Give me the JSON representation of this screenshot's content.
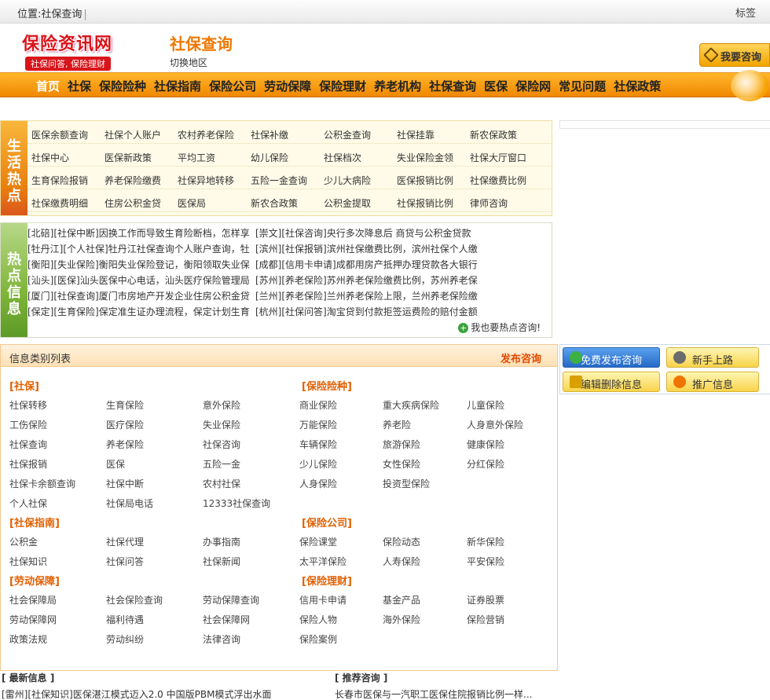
{
  "topbar": {
    "location_label": "位置:社保查询",
    "tags_label": "标签"
  },
  "header": {
    "logo_text": "保险资讯网",
    "logo_slogan": "社保问答, 保险理财",
    "page_title": "社保查询",
    "switch_region": "切换地区",
    "ask_button": "我要咨询"
  },
  "nav": {
    "items": [
      "首页",
      "社保",
      "保险险种",
      "社保指南",
      "保险公司",
      "劳动保障",
      "保险理财",
      "养老机构",
      "社保查询",
      "医保",
      "保险网",
      "常见问题",
      "社保政策"
    ]
  },
  "hot": {
    "tab_label": "生活热点",
    "rows": [
      [
        "医保余额查询",
        "社保个人账户",
        "农村养老保险",
        "社保补缴",
        "公积金查询",
        "社保挂靠",
        "新农保政策"
      ],
      [
        "社保中心",
        "医保新政策",
        "平均工资",
        "幼儿保险",
        "社保档次",
        "失业保险金领",
        "社保大厅窗口"
      ],
      [
        "生育保险报销",
        "养老保险缴费",
        "社保异地转移",
        "五险一金查询",
        "少儿大病险",
        "医保报销比例",
        "社保缴费比例"
      ],
      [
        "社保缴费明细",
        "住房公积金贷",
        "医保局",
        "新农合政策",
        "公积金提取",
        "社保报销比例",
        "律师咨询"
      ]
    ]
  },
  "news": {
    "tab_label": "热点信息",
    "lines": [
      [
        "[北碚][社保中断]因换工作而导致生育险断档，怎样享",
        "[崇文][社保咨询]央行多次降息后 商贷与公积金贷款"
      ],
      [
        "[牡丹江][个人社保]牡丹江社保查询个人账户查询，牡",
        "[滨州][社保报销]滨州社保缴费比例，滨州社保个人缴"
      ],
      [
        "[衡阳][失业保险]衡阳失业保险登记，衡阳领取失业保",
        "[成都][信用卡申请]成都用房产抵押办理贷款各大银行"
      ],
      [
        "[汕头][医保]汕头医保中心电话，汕头医疗保险管理局",
        "[苏州][养老保险]苏州养老保险缴费比例，苏州养老保"
      ],
      [
        "[厦门][社保查询]厦门市房地产开发企业住房公积金贷",
        "[兰州][养老保险]兰州养老保险上限，兰州养老保险缴"
      ],
      [
        "[保定][生育保险]保定准生证办理流程，保定计划生育",
        "[杭州][社保问答]淘宝贷到付款拒签运费险的赔付金额"
      ]
    ],
    "more_label": "我也要热点咨询!"
  },
  "info": {
    "title": "信息类别列表",
    "publish": "发布咨询",
    "categories": [
      {
        "name": "[社保]",
        "links": [
          "社保转移",
          "生育保险",
          "意外保险",
          "工伤保险",
          "医疗保险",
          "失业保险",
          "社保查询",
          "养老保险",
          "社保咨询",
          "社保报销",
          "医保",
          "五险一金",
          "社保卡余额查询",
          "社保中断",
          "农村社保",
          "个人社保",
          "社保局电话",
          "12333社保查询"
        ]
      },
      {
        "name": "[保险险种]",
        "links": [
          "商业保险",
          "重大疾病保险",
          "儿童保险",
          "万能保险",
          "养老险",
          "人身意外保险",
          "车辆保险",
          "旅游保险",
          "健康保险",
          "少儿保险",
          "女性保险",
          "分红保险",
          "人身保险",
          "投资型保险"
        ]
      },
      {
        "name": "[社保指南]",
        "links": [
          "公积金",
          "社保代理",
          "办事指南",
          "社保知识",
          "社保问答",
          "社保新闻"
        ]
      },
      {
        "name": "[保险公司]",
        "links": [
          "保险课堂",
          "保险动态",
          "新华保险",
          "太平洋保险",
          "人寿保险",
          "平安保险"
        ]
      },
      {
        "name": "[劳动保障]",
        "links": [
          "社会保障局",
          "社会保险查询",
          "劳动保障查询",
          "劳动保障网",
          "福利待遇",
          "社会保障网",
          "政策法规",
          "劳动纠纷",
          "法律咨询"
        ]
      },
      {
        "name": "[保险理财]",
        "links": [
          "信用卡申请",
          "基金产品",
          "证券股票",
          "保险人物",
          "海外保险",
          "保险营销",
          "保险案例"
        ]
      }
    ]
  },
  "side": {
    "btn_publish": "免费发布咨询",
    "btn_newbie": "新手上路",
    "btn_edit": "编辑删除信息",
    "btn_promote": "推广信息"
  },
  "bottom": {
    "latest_title": "最新信息",
    "latest_line": "[雷州][社保知识]医保湛江模式迈入2.0 中国版PBM模式浮出水面",
    "recommend_title": "推荐咨询",
    "recommend_line": "长春市医保与一汽职工医保住院报销比例一样..."
  }
}
